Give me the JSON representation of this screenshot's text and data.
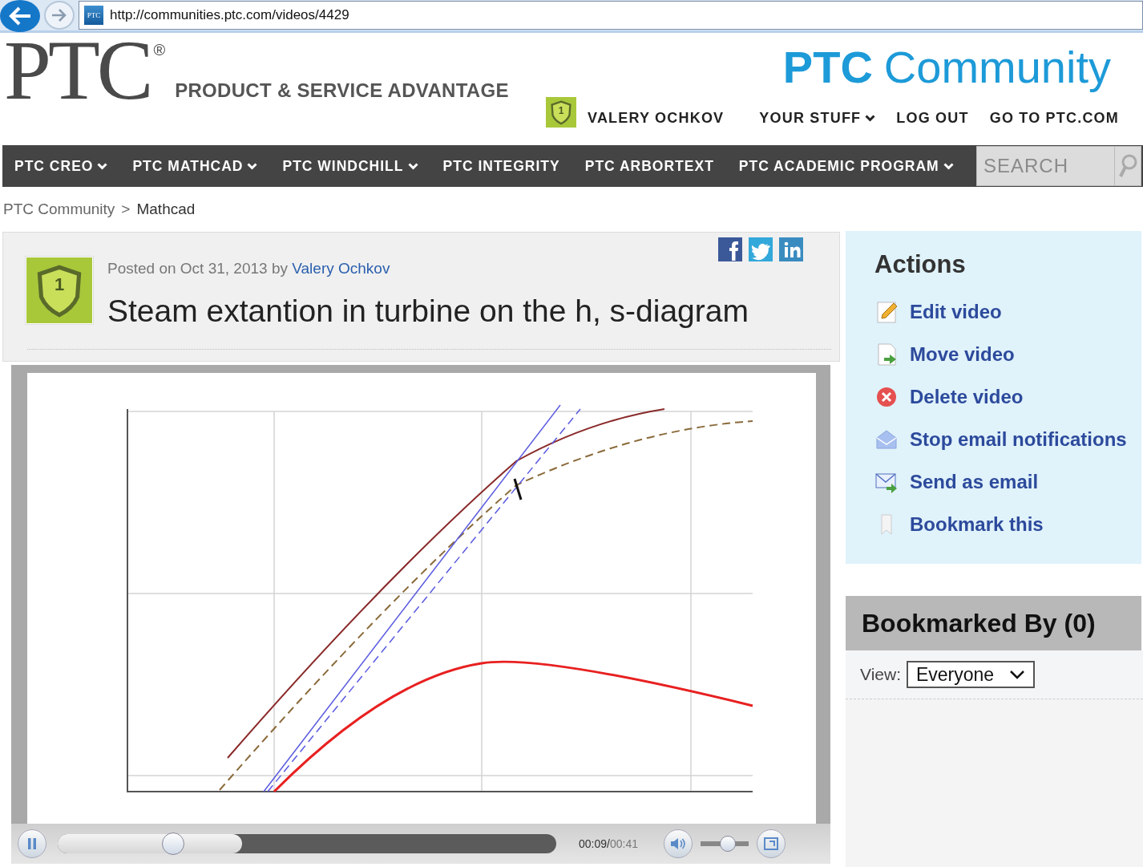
{
  "browser": {
    "favicon_text": "PTC",
    "url": "http://communities.ptc.com/videos/4429"
  },
  "header": {
    "logo": "PTC",
    "logo_mark": "®",
    "tagline": "PRODUCT & SERVICE ADVANTAGE",
    "brand_bold": "PTC",
    "brand_word": "Community",
    "user_badge": "1",
    "user": "VALERY OCHKOV",
    "links": [
      {
        "label": "YOUR STUFF",
        "dropdown": true
      },
      {
        "label": "LOG OUT",
        "dropdown": false
      },
      {
        "label": "GO TO PTC.COM",
        "dropdown": false
      }
    ]
  },
  "nav": {
    "items": [
      {
        "label": "PTC CREO",
        "dropdown": true
      },
      {
        "label": "PTC MATHCAD",
        "dropdown": true
      },
      {
        "label": "PTC WINDCHILL",
        "dropdown": true
      },
      {
        "label": "PTC INTEGRITY",
        "dropdown": false
      },
      {
        "label": "PTC ARBORTEXT",
        "dropdown": false
      },
      {
        "label": "PTC ACADEMIC PROGRAM",
        "dropdown": true
      }
    ],
    "search": {
      "placeholder": "SEARCH"
    }
  },
  "breadcrumb": {
    "items": [
      "PTC Community",
      "Mathcad"
    ],
    "separator": ">"
  },
  "post": {
    "badge": "1",
    "meta": "Posted on Oct 31, 2013 by",
    "author": "Valery Ochkov",
    "title": "Steam extantion in turbine on the h, s-diagram",
    "share": [
      {
        "kind": "facebook"
      },
      {
        "kind": "twitter"
      },
      {
        "kind": "linkedin"
      }
    ]
  },
  "player": {
    "playing": true,
    "buffer": {
      "level": 0.37
    },
    "seek": {
      "level": 0.23
    },
    "time_elapsed": "00:09/",
    "time_total": "00:41",
    "volume": {
      "level": 0.55
    }
  },
  "actions": {
    "title": "Actions",
    "items": [
      {
        "kind": "edit",
        "label": "Edit video"
      },
      {
        "kind": "move",
        "label": "Move video"
      },
      {
        "kind": "delete",
        "label": "Delete video"
      },
      {
        "kind": "stop_email",
        "label": "Stop email notifications"
      },
      {
        "kind": "send_email",
        "label": "Send as email"
      },
      {
        "kind": "bookmark",
        "label": "Bookmark this"
      }
    ]
  },
  "bookmarked": {
    "title": "Bookmarked By (0)",
    "view_label": "View:",
    "view_value": "Everyone"
  }
}
